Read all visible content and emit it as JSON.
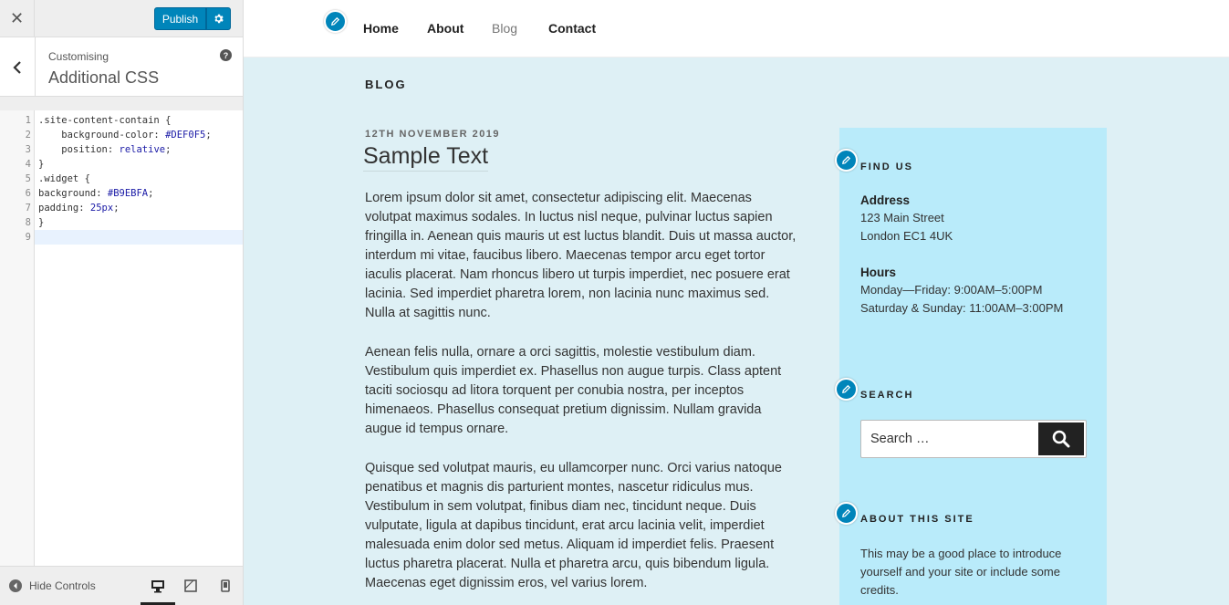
{
  "sidebar": {
    "close_label": "✕",
    "publish_label": "Publish",
    "section_subtitle": "Customising",
    "section_title": "Additional CSS",
    "help_label": "?",
    "code_lines": [
      {
        "n": "1",
        "text": ".site-content-contain {"
      },
      {
        "n": "2",
        "text": "    background-color: #DEF0F5;"
      },
      {
        "n": "3",
        "text": "    position: relative;"
      },
      {
        "n": "4",
        "text": "}"
      },
      {
        "n": "5",
        "text": ".widget {"
      },
      {
        "n": "6",
        "text": "background: #B9EBFA;"
      },
      {
        "n": "7",
        "text": "padding: 25px;"
      },
      {
        "n": "8",
        "text": "}"
      },
      {
        "n": "9",
        "text": ""
      }
    ],
    "hide_controls_label": "Hide Controls"
  },
  "site": {
    "nav": [
      "Home",
      "About",
      "Blog",
      "Contact"
    ],
    "current_nav": "Blog",
    "page_heading": "BLOG",
    "post": {
      "date": "12TH NOVEMBER 2019",
      "title": "Sample Text",
      "paragraphs": [
        "Lorem ipsum dolor sit amet, consectetur adipiscing elit. Maecenas volutpat maximus sodales. In luctus nisl neque, pulvinar luctus sapien fringilla in. Aenean quis mauris ut est luctus blandit. Duis ut massa auctor, interdum mi vitae, faucibus libero. Maecenas tempor arcu eget tortor iaculis placerat. Nam rhoncus libero ut turpis imperdiet, nec posuere erat lacinia. Sed imperdiet pharetra lorem, non lacinia nunc maximus sed. Nulla at sagittis nunc.",
        "Aenean felis nulla, ornare a orci sagittis, molestie vestibulum diam. Vestibulum quis imperdiet ex. Phasellus non augue turpis. Class aptent taciti sociosqu ad litora torquent per conubia nostra, per inceptos himenaeos. Phasellus consequat pretium dignissim. Nullam gravida augue id tempus ornare.",
        "Quisque sed volutpat mauris, eu ullamcorper nunc. Orci varius natoque penatibus et magnis dis parturient montes, nascetur ridiculus mus. Vestibulum in sem volutpat, finibus diam nec, tincidunt neque. Duis vulputate, ligula at dapibus tincidunt, erat arcu lacinia velit, imperdiet malesuada enim dolor sed metus. Aliquam id imperdiet felis. Praesent luctus pharetra placerat. Nulla et pharetra arcu, quis bibendum ligula. Maecenas eget dignissim eros, vel varius lorem."
      ]
    },
    "widgets": {
      "find_us": {
        "title": "FIND US",
        "address_label": "Address",
        "address_line1": "123 Main Street",
        "address_line2": "London EC1 4UK",
        "hours_label": "Hours",
        "hours_line1": "Monday—Friday: 9:00AM–5:00PM",
        "hours_line2": "Saturday & Sunday: 11:00AM–3:00PM"
      },
      "search": {
        "title": "SEARCH",
        "placeholder": "Search …"
      },
      "about": {
        "title": "ABOUT THIS SITE",
        "text": "This may be a good place to introduce yourself and your site or include some credits."
      }
    }
  },
  "colors": {
    "accent": "#0085ba",
    "content_bg": "#DEF0F5",
    "widget_bg": "#B9EBFA"
  },
  "icons": {
    "close": "close-icon",
    "settings": "gear-icon",
    "back": "chevron-left-icon",
    "help": "help-icon",
    "edit": "pencil-icon",
    "search": "search-icon",
    "hide_controls": "arrow-left-circle-icon",
    "devices": [
      "desktop-icon",
      "tablet-icon",
      "mobile-icon"
    ]
  }
}
